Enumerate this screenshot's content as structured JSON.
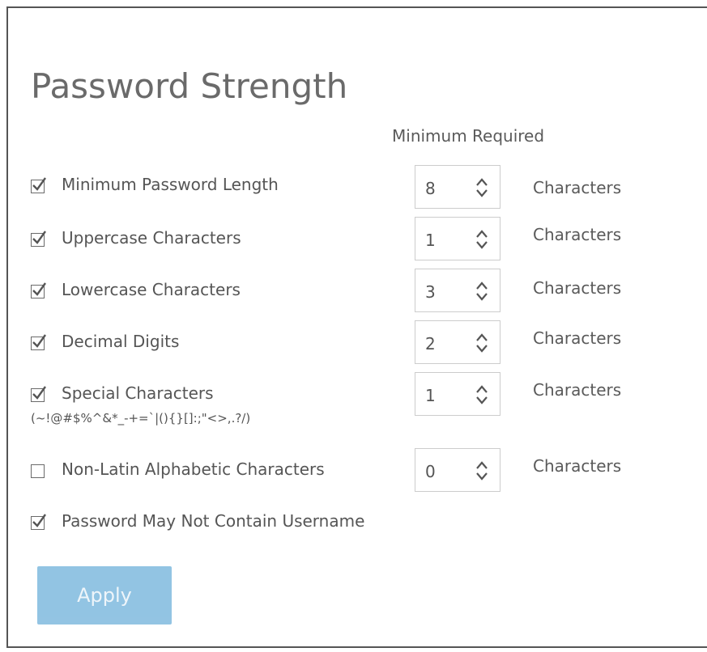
{
  "title": "Password Strength",
  "column_header": "Minimum Required",
  "rules": [
    {
      "label": "Minimum Password Length",
      "checked": true,
      "value": "8",
      "unit": "Characters"
    },
    {
      "label": "Uppercase Characters",
      "checked": true,
      "value": "1",
      "unit": "Characters"
    },
    {
      "label": "Lowercase Characters",
      "checked": true,
      "value": "3",
      "unit": "Characters"
    },
    {
      "label": "Decimal Digits",
      "checked": true,
      "value": "2",
      "unit": "Characters"
    },
    {
      "label": "Special Characters",
      "note": "(~!@#$%^&*_-+=`|(){}[]:;\"<>,.?/)",
      "checked": true,
      "value": "1",
      "unit": "Characters"
    },
    {
      "label": "Non-Latin Alphabetic Characters",
      "checked": false,
      "value": "0",
      "unit": "Characters"
    }
  ],
  "username_rule": {
    "label": "Password May Not Contain Username",
    "checked": true
  },
  "apply_label": "Apply"
}
